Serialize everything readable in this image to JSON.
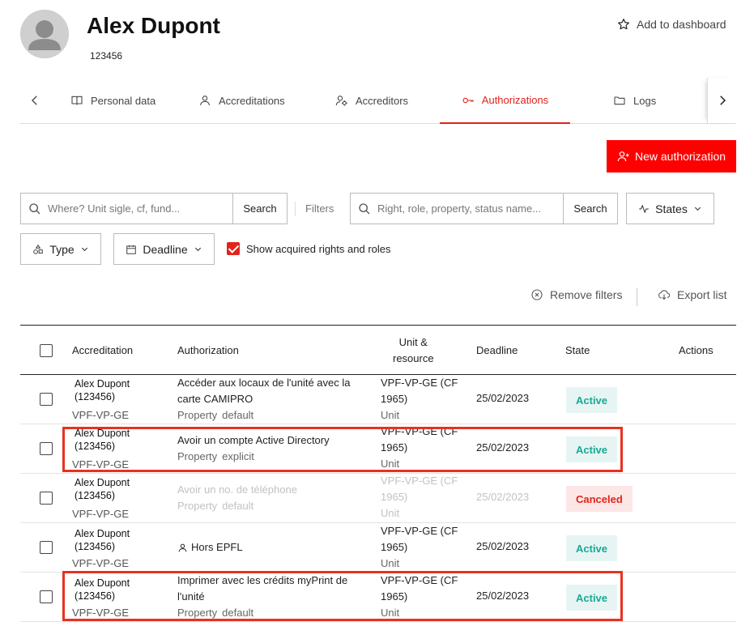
{
  "header": {
    "name": "Alex Dupont",
    "id": "123456",
    "add_to_dashboard": "Add to dashboard"
  },
  "tabs": [
    {
      "label": "Personal data",
      "icon": "book-icon"
    },
    {
      "label": "Accreditations",
      "icon": "person-icon"
    },
    {
      "label": "Accreditors",
      "icon": "user-gear-icon"
    },
    {
      "label": "Authorizations",
      "icon": "key-icon",
      "active": true
    },
    {
      "label": "Logs",
      "icon": "folder-icon"
    }
  ],
  "actions": {
    "new_authorization": "New authorization"
  },
  "filters": {
    "unit_search_placeholder": "Where? Unit sigle, cf, fund...",
    "unit_search_button": "Search",
    "filters_label": "Filters",
    "right_search_placeholder": "Right, role, property, status name...",
    "right_search_button": "Search",
    "states": "States",
    "type": "Type",
    "deadline": "Deadline",
    "show_acquired": "Show acquired rights and roles",
    "show_acquired_checked": true,
    "remove_filters": "Remove filters",
    "export_list": "Export list"
  },
  "table": {
    "columns": {
      "accreditation": "Accreditation",
      "authorization": "Authorization",
      "unit_line1": "Unit &",
      "unit_line2": "resource",
      "deadline": "Deadline",
      "state": "State",
      "actions": "Actions"
    },
    "rows": [
      {
        "acc_name": "Alex Dupont",
        "acc_id": "(123456)",
        "acc_unit": "VPF-VP-GE",
        "auth_line1": "Accéder aux locaux de l'unité avec la",
        "auth_line2": "carte CAMIPRO",
        "auth_kind": "Property",
        "auth_mode": "default",
        "unit_line1": "VPF-VP-GE (CF",
        "unit_line2": "1965)",
        "unit_type": "Unit",
        "deadline": "25/02/2023",
        "state": "Active"
      },
      {
        "acc_name": "Alex Dupont",
        "acc_id": "(123456)",
        "acc_unit": "VPF-VP-GE",
        "auth_line1": "Avoir un compte Active Directory",
        "auth_kind": "Property",
        "auth_mode": "explicit",
        "unit_line1": "VPF-VP-GE (CF",
        "unit_line2": "1965)",
        "unit_type": "Unit",
        "deadline": "25/02/2023",
        "state": "Active"
      },
      {
        "acc_name": "Alex Dupont",
        "acc_id": "(123456)",
        "acc_unit": "VPF-VP-GE",
        "auth_line1": "Avoir un no. de téléphone",
        "auth_kind": "Property",
        "auth_mode": "default",
        "unit_line1": "VPF-VP-GE (CF",
        "unit_line2": "1965)",
        "unit_type": "Unit",
        "deadline": "25/02/2023",
        "state": "Canceled"
      },
      {
        "acc_name": "Alex Dupont",
        "acc_id": "(123456)",
        "acc_unit": "VPF-VP-GE",
        "auth_line1": "Hors EPFL",
        "unit_line1": "VPF-VP-GE (CF",
        "unit_line2": "1965)",
        "unit_type": "Unit",
        "deadline": "25/02/2023",
        "state": "Active"
      },
      {
        "acc_name": "Alex Dupont",
        "acc_id": "(123456)",
        "acc_unit": "VPF-VP-GE",
        "auth_line1": "Imprimer avec les crédits myPrint de",
        "auth_line2": "l'unité",
        "auth_kind": "Property",
        "auth_mode": "default",
        "unit_line1": "VPF-VP-GE (CF",
        "unit_line2": "1965)",
        "unit_type": "Unit",
        "deadline": "25/02/2023",
        "state": "Active"
      }
    ]
  },
  "colors": {
    "accent": "#e2231a",
    "primary_button": "#ff0000",
    "active_badge_bg": "#e6f5f3",
    "active_badge_text": "#1aa894",
    "canceled_badge_bg": "#fde6e6",
    "highlight_border": "#e8321f"
  }
}
